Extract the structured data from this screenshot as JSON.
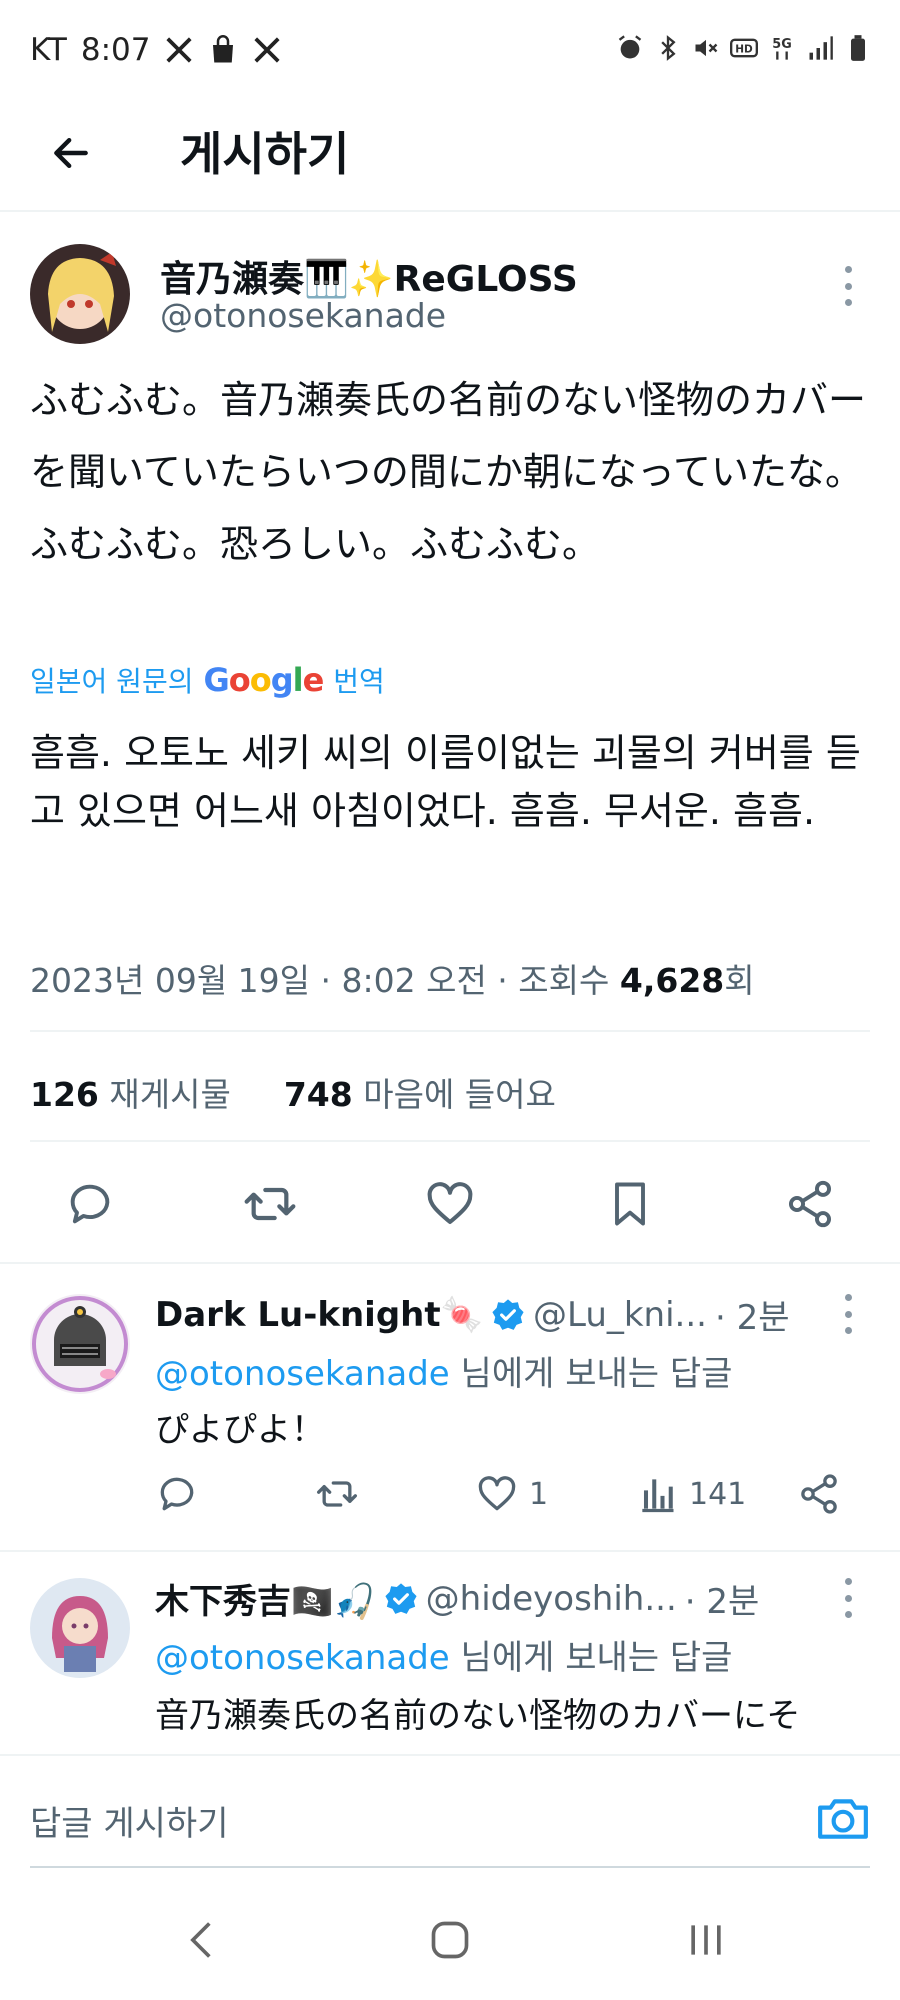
{
  "status_bar": {
    "carrier": "KT",
    "time": "8:07",
    "icons": [
      "x-logo-icon",
      "shopping-bag-icon",
      "x-logo-icon",
      "alarm-icon",
      "bluetooth-icon",
      "mute-icon",
      "hd-voice-icon",
      "5g-icon",
      "signal-icon",
      "battery-icon"
    ]
  },
  "header": {
    "back_icon": "arrow-left-icon",
    "title": "게시하기"
  },
  "post": {
    "author_name": "音乃瀬奏🎹✨ReGLOSS",
    "author_handle": "@otonosekanade",
    "text": "ふむふむ。音乃瀬奏氏の名前のない怪物のカバーを聞いていたらいつの間にか朝になっていたな。ふむふむ。恐ろしい。ふむふむ。",
    "translate_prefix": "일본어 원문의",
    "translate_brand": "Google",
    "translate_suffix": "번역",
    "translated_text": "흠흠. 오토노 세키 씨의 이름이없는 괴물의 커버를 듣고 있으면 어느새 아침이었다. 흠흠. 무서운. 흠흠.",
    "meta_prefix": "2023년 09월 19일 · 8:02 오전 · 조회수 ",
    "views": "4,628",
    "views_suffix": "회",
    "reposts_count": "126",
    "reposts_label": "재게시물",
    "likes_count": "748",
    "likes_label": "마음에 들어요"
  },
  "actions": [
    "reply-icon",
    "repost-icon",
    "like-icon",
    "bookmark-icon",
    "share-icon"
  ],
  "replies": [
    {
      "name": "Dark Lu-knight🍬",
      "handle": "@Lu_kni...",
      "time": "· 2분",
      "reply_prefix": "",
      "mention": "@otonosekanade",
      "reply_suffix": " 님에게 보내는 답글",
      "text": "ぴよぴよ！",
      "likes": "1",
      "views": "141"
    },
    {
      "name": "木下秀吉🏴‍☠️🎣",
      "handle": "@hideyoshih...",
      "time": "· 2분",
      "mention": "@otonosekanade",
      "reply_suffix": " 님에게 보내는 답글",
      "text": "音乃瀬奏氏の名前のない怪物のカバーにそ"
    }
  ],
  "composer": {
    "placeholder": "답글 게시하기",
    "camera_icon": "camera-icon"
  },
  "nav_bar": [
    "back-nav-icon",
    "home-nav-icon",
    "recents-nav-icon"
  ],
  "colors": {
    "accent": "#1d9bf0",
    "text": "#0f1419",
    "muted": "#536471"
  }
}
